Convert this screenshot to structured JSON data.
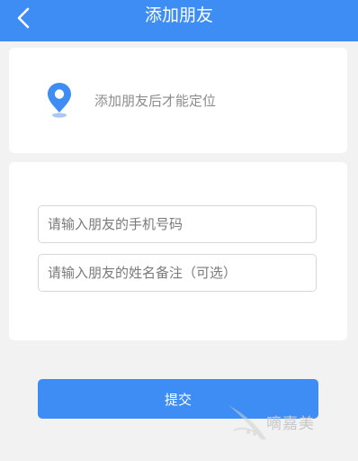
{
  "header": {
    "title": "添加朋友",
    "back_icon": "chevron-left-icon"
  },
  "location_card": {
    "icon": "location-pin-icon",
    "hint": "添加朋友后才能定位"
  },
  "form": {
    "phone_placeholder": "请输入朋友的手机号码",
    "name_placeholder": "请输入朋友的姓名备注（可选）"
  },
  "submit": {
    "label": "提交"
  },
  "watermark": {
    "text": "嘀嘉美"
  },
  "colors": {
    "accent": "#3d8df5",
    "background": "#f2f2f2",
    "card": "#ffffff",
    "hint_text": "#8c8c8c"
  }
}
